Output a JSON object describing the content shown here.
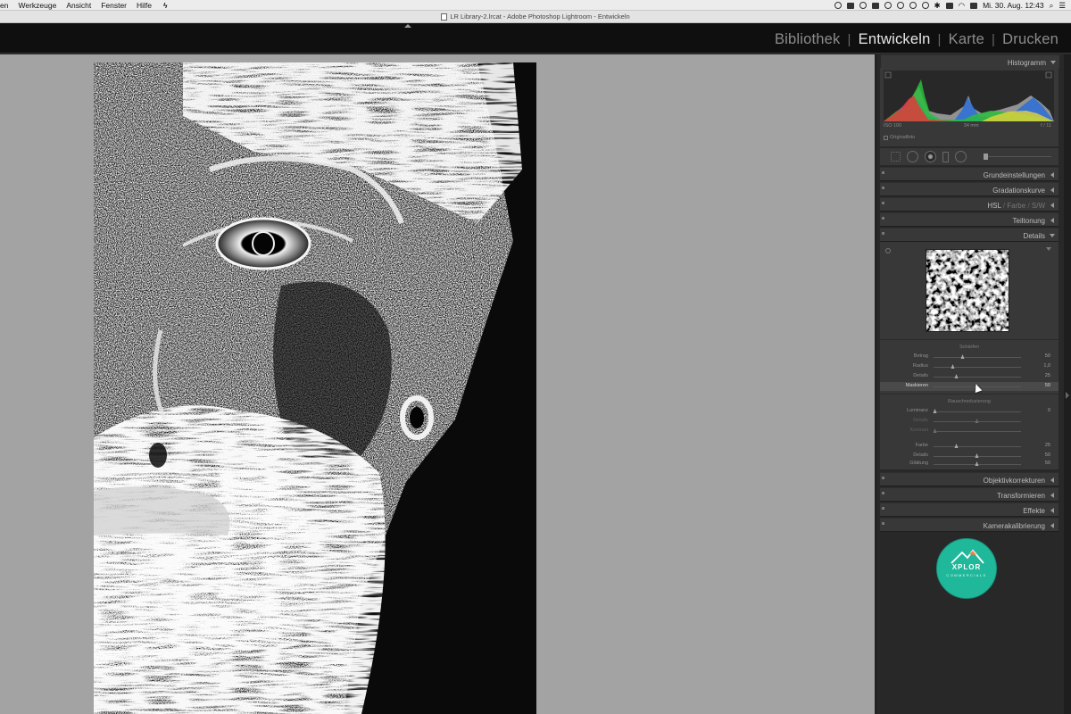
{
  "menubar": {
    "items": [
      "en",
      "Werkzeuge",
      "Ansicht",
      "Fenster",
      "Hilfe"
    ],
    "clock": "Mi. 30. Aug.  12:43"
  },
  "window": {
    "title": "LR Library-2.lrcat - Adobe Photoshop Lightroom - Entwickeln"
  },
  "modules": {
    "bibliothek": "Bibliothek",
    "entwickeln": "Entwickeln",
    "karte": "Karte",
    "drucken": "Drucken",
    "active": "Entwickeln"
  },
  "panels": {
    "histogram": "Histogramm",
    "grundeinstellungen": "Grundeinstellungen",
    "gradationskurve": "Gradationskurve",
    "hsl": "HSL",
    "farbe": "Farbe",
    "sw": "S/W",
    "teiltonung": "Teiltonung",
    "details": "Details",
    "objektivkorrekturen": "Objektivkorrekturen",
    "transformieren": "Transformieren",
    "effekte": "Effekte",
    "kamerakalibrierung": "Kamerakalibrierung"
  },
  "histogram_info": {
    "iso": "ISO 100",
    "focal": "34 mm",
    "aperture": "f / 11",
    "original": "Originalfoto"
  },
  "scharfen": {
    "title": "Schärfen",
    "rows": [
      {
        "name": "Betrag",
        "value": "50",
        "pos": 0.34
      },
      {
        "name": "Radius",
        "value": "1,0",
        "pos": 0.22
      },
      {
        "name": "Details",
        "value": "25",
        "pos": 0.27
      },
      {
        "name": "Maskieren",
        "value": "50",
        "pos": 0.5
      }
    ]
  },
  "rausch": {
    "title": "Rauschreduzierung",
    "rows": [
      {
        "name": "Luminanz",
        "value": "0",
        "pos": 0.02
      },
      {
        "name": "Details",
        "value": "",
        "pos": 0.5
      },
      {
        "name": "Kontrast",
        "value": "",
        "pos": 0.02
      },
      {
        "name": "Farbe",
        "value": "25",
        "pos": 0.27
      },
      {
        "name": "Details",
        "value": "50",
        "pos": 0.5
      },
      {
        "name": "Glättung",
        "value": "50",
        "pos": 0.5
      }
    ]
  },
  "logo": {
    "name": "XPLOR",
    "tagline": "COMMERCIALS"
  },
  "colors": {
    "accent_logo": "#1fb89a",
    "canvas_bg": "#a3a3a3",
    "panel_bg": "#383838"
  }
}
